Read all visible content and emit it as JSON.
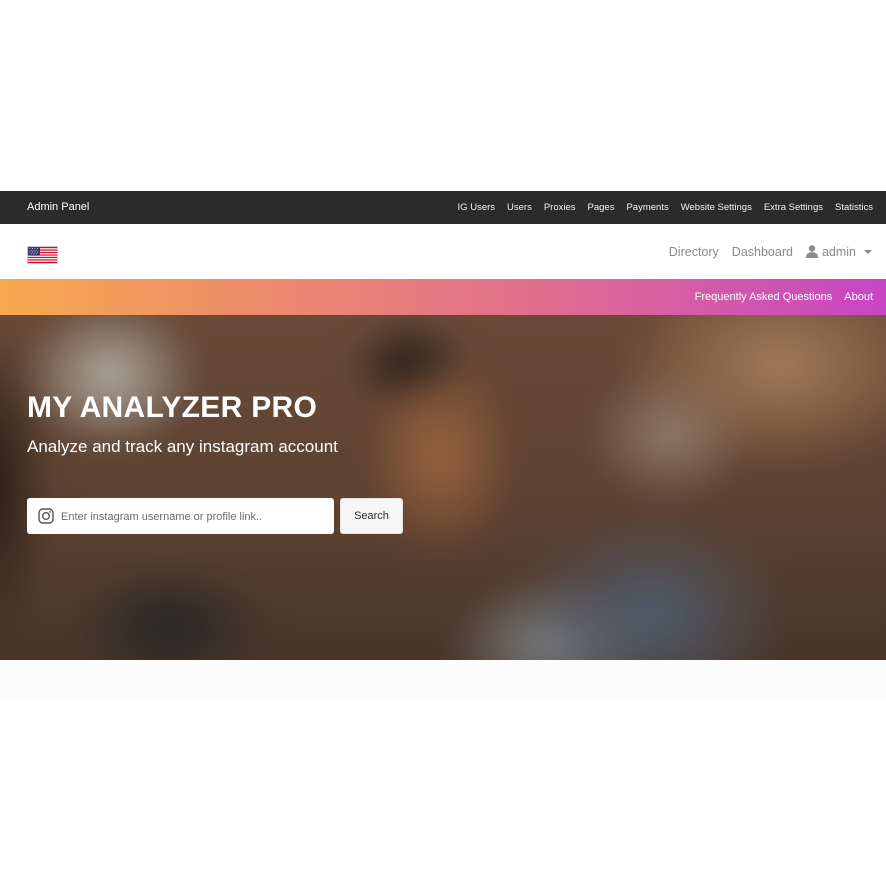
{
  "admin_bar": {
    "brand": "Admin Panel",
    "links": [
      "IG Users",
      "Users",
      "Proxies",
      "Pages",
      "Payments",
      "Website Settings",
      "Extra Settings",
      "Statistics"
    ]
  },
  "main_nav": {
    "flag_icon": "us-flag-icon",
    "directory": "Directory",
    "dashboard": "Dashboard",
    "user_icon": "user-icon",
    "user": "admin"
  },
  "secondary_nav": {
    "faq": "Frequently Asked Questions",
    "about": "About",
    "gradient_start": "#f7a94e",
    "gradient_end": "#c745c5"
  },
  "hero": {
    "title": "MY ANALYZER PRO",
    "subtitle": "Analyze and track any instagram account",
    "search_placeholder": "Enter instagram username or profile link..",
    "search_icon": "instagram-icon",
    "search_button": "Search"
  }
}
